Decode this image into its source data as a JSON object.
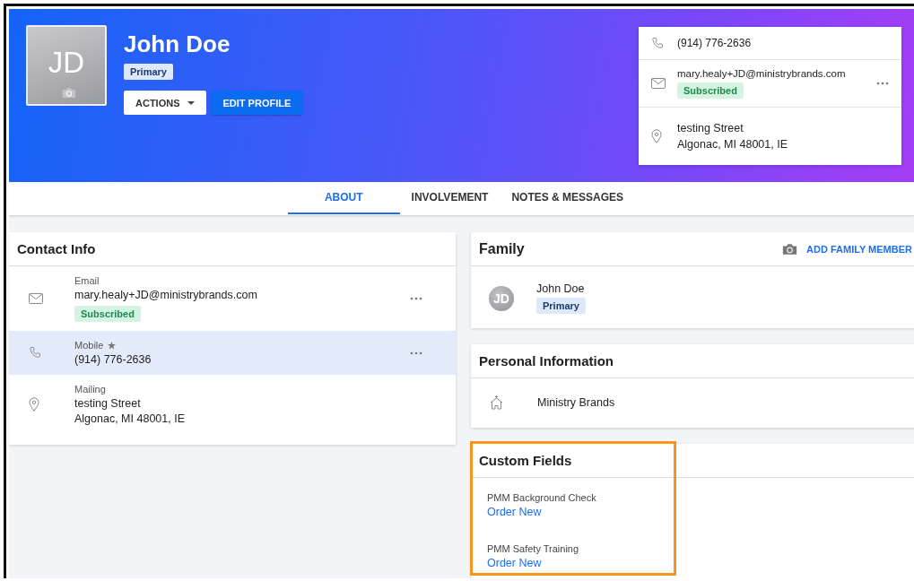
{
  "profile": {
    "initials": "JD",
    "name": "John Doe",
    "badge": "Primary",
    "actions_button": "ACTIONS",
    "edit_button": "EDIT PROFILE"
  },
  "quick_contact": [
    {
      "kind": "phone",
      "lines": [
        "(914) 776-2636"
      ],
      "has_menu": false
    },
    {
      "kind": "email",
      "lines": [
        "mary.healy+JD@ministrybrands.com"
      ],
      "badge": "Subscribed",
      "has_menu": true
    },
    {
      "kind": "address",
      "lines": [
        "testing Street",
        "Algonac, MI 48001, IE"
      ],
      "has_menu": false
    }
  ],
  "tabs": [
    {
      "label": "ABOUT",
      "selected": true
    },
    {
      "label": "INVOLVEMENT",
      "selected": false
    },
    {
      "label": "NOTES & MESSAGES",
      "selected": false
    }
  ],
  "contact_info": {
    "title": "Contact Info",
    "items": [
      {
        "kind": "email",
        "label": "Email",
        "preferred": false,
        "lines": [
          "mary.healy+JD@ministrybrands.com"
        ],
        "badge": "Subscribed",
        "has_menu": true,
        "selected": false
      },
      {
        "kind": "phone",
        "label": "Mobile",
        "preferred": true,
        "lines": [
          "(914) 776-2636"
        ],
        "has_menu": true,
        "selected": true
      },
      {
        "kind": "address",
        "label": "Mailing",
        "preferred": false,
        "lines": [
          "testing Street",
          "Algonac, MI 48001, IE"
        ],
        "has_menu": false,
        "selected": false
      }
    ]
  },
  "family": {
    "title": "Family",
    "add_button": "ADD FAMILY MEMBER",
    "members": [
      {
        "initials": "JD",
        "name": "John Doe",
        "badge": "Primary"
      }
    ]
  },
  "personal_information": {
    "title": "Personal Information",
    "items": [
      {
        "kind": "organization",
        "value": "Ministry Brands"
      }
    ]
  },
  "custom_fields": {
    "title": "Custom Fields",
    "highlighted": true,
    "fields": [
      {
        "label": "PMM Background Check",
        "link": "Order New"
      },
      {
        "label": "PMM Safety Training",
        "link": "Order New"
      }
    ]
  }
}
